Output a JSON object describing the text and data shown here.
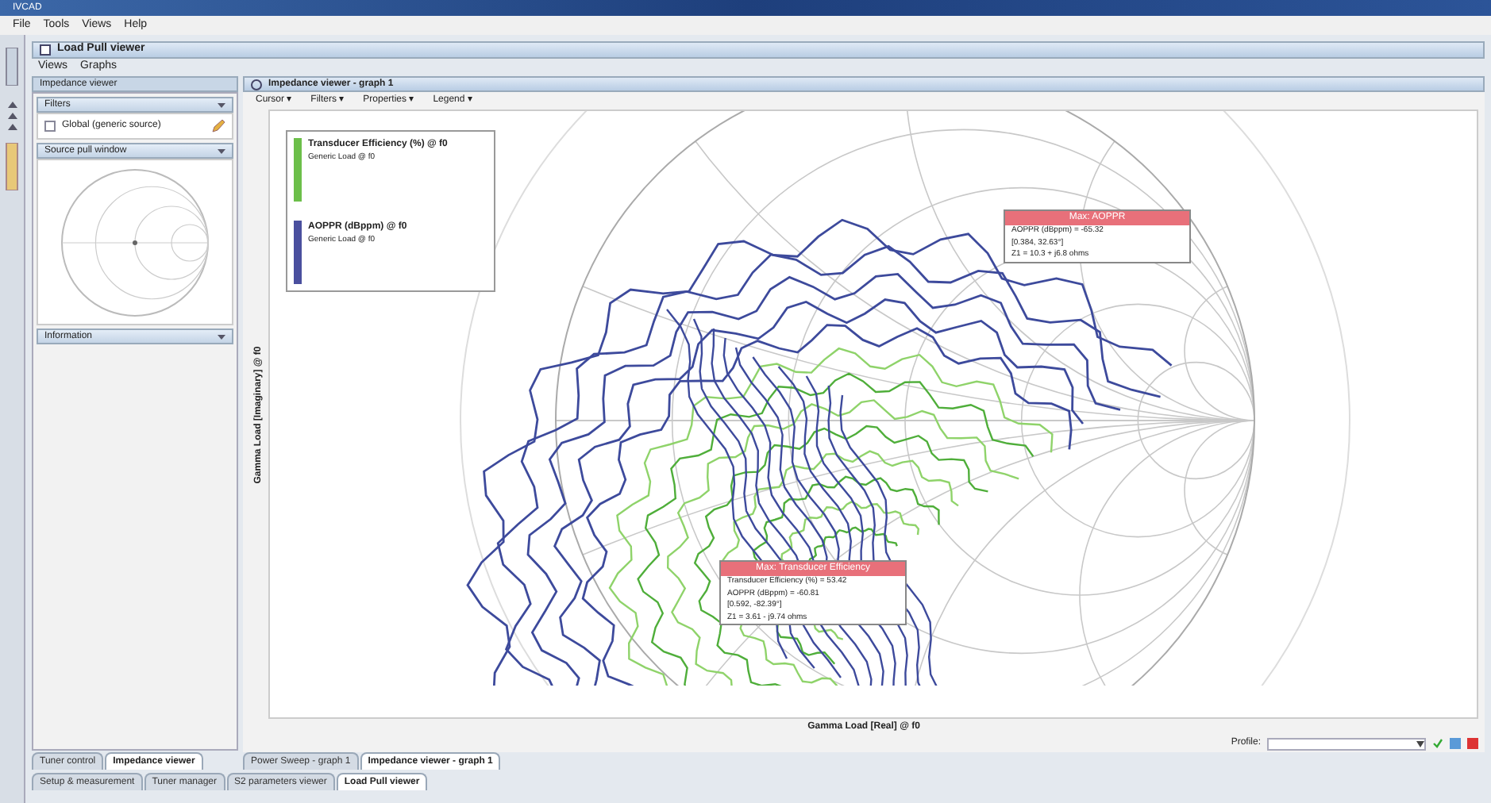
{
  "window": {
    "title": "IVCAD"
  },
  "menu": [
    "File",
    "Tools",
    "Views",
    "Help"
  ],
  "viewer": {
    "title": "Load Pull viewer",
    "menu": [
      "Views",
      "Graphs"
    ]
  },
  "left_panel": {
    "title": "Impedance viewer",
    "sections": [
      {
        "title": "Filters",
        "kind": "filters",
        "checkbox": {
          "label": "Global (generic source)",
          "checked": false
        }
      },
      {
        "title": "Source pull window",
        "kind": "preview"
      },
      {
        "title": "Information",
        "kind": "empty"
      }
    ],
    "tabs": [
      {
        "label": "Tuner control",
        "selected": false
      },
      {
        "label": "Impedance viewer",
        "selected": true
      }
    ]
  },
  "graph": {
    "title": "Impedance viewer - graph 1",
    "toolbar": [
      "Cursor ▾",
      "Filters ▾",
      "Properties ▾",
      "Legend ▾"
    ],
    "legend": [
      {
        "title": "Transducer Efficiency (%) @ f0",
        "subtitle": "Generic Load @ f0",
        "color": "#6cbf4a"
      },
      {
        "title": "AOPPR (dBppm) @ f0",
        "subtitle": "Generic Load @ f0",
        "color": "#4a4f9e"
      }
    ],
    "ylabel": "Gamma Load [Imaginary] @ f0",
    "xlabel": "Gamma Load [Real] @ f0",
    "tooltips": [
      {
        "title": "Max: AOPPR",
        "lines": [
          "AOPPR (dBppm) = -65.32",
          "[0.384, 32.63°]",
          "Z1 = 10.3 + j6.8 ohms"
        ]
      },
      {
        "title": "Max: Transducer Efficiency",
        "lines": [
          "Transducer Efficiency (%) = 53.42",
          "AOPPR (dBppm) = -60.81",
          "[0.592, -82.39°]",
          "Z1 = 3.61 - j9.74 ohms"
        ]
      }
    ],
    "profile_label": "Profile:",
    "tabs": [
      {
        "label": "Power Sweep - graph 1",
        "selected": false
      },
      {
        "label": "Impedance viewer - graph 1",
        "selected": true
      }
    ]
  },
  "bottom_tabs": [
    {
      "label": "Setup & measurement",
      "selected": false
    },
    {
      "label": "Tuner manager",
      "selected": false
    },
    {
      "label": "S2 parameters viewer",
      "selected": false
    },
    {
      "label": "Load Pull viewer",
      "selected": true
    }
  ]
}
